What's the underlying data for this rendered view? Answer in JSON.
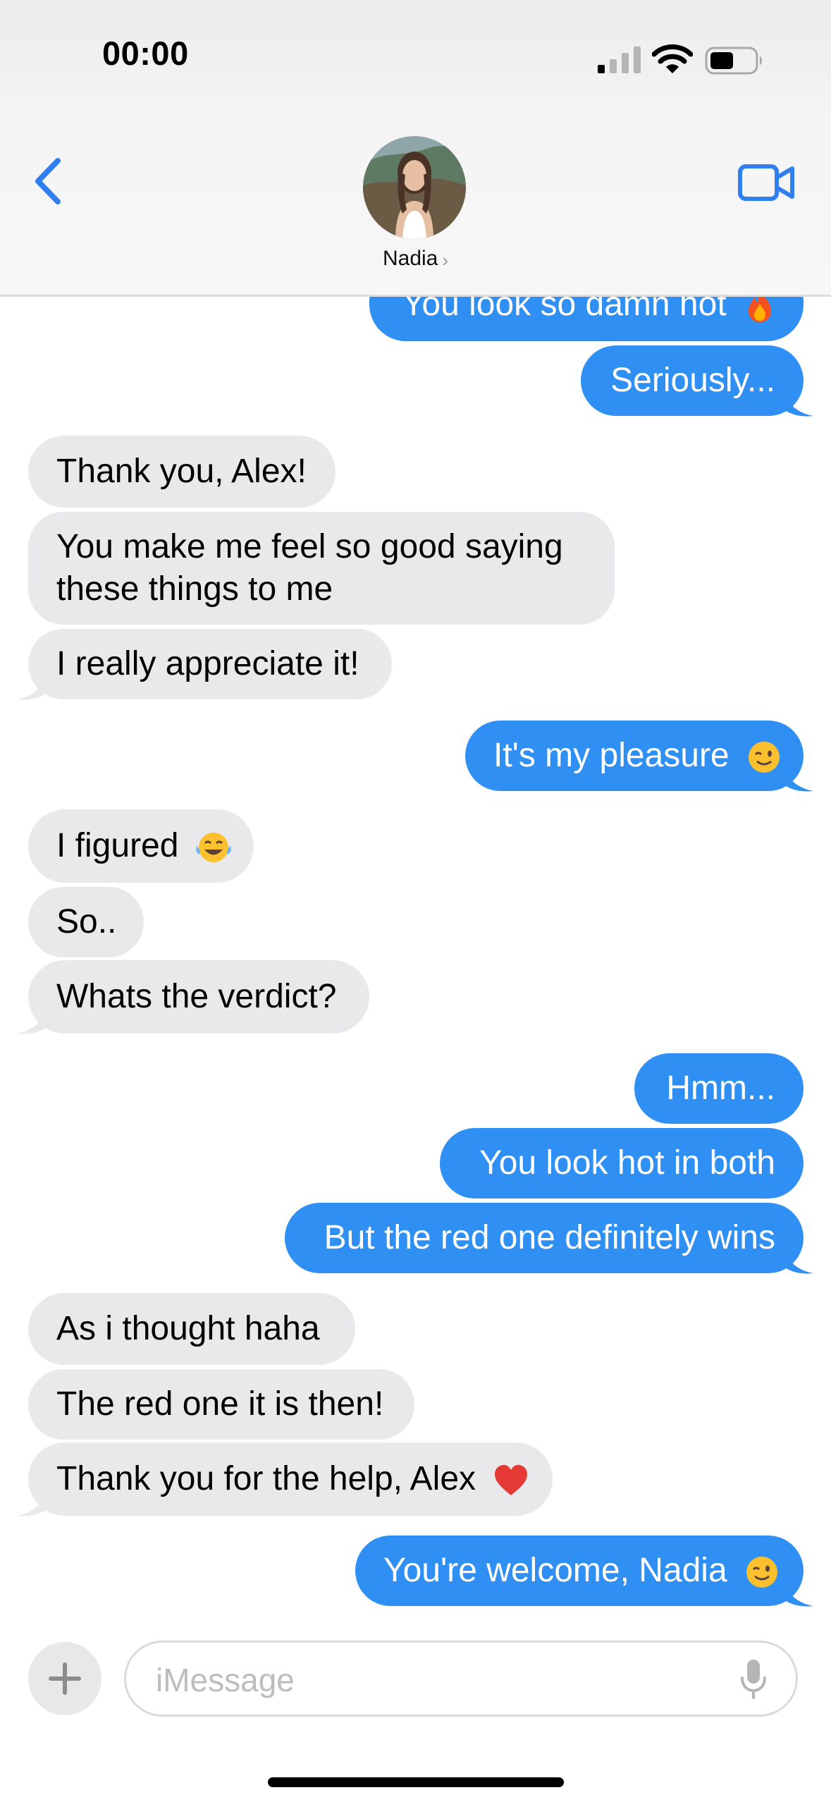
{
  "status_bar": {
    "time": "00:00"
  },
  "header": {
    "contact_name": "Nadia",
    "contact_chevron": "›",
    "back_icon": "chevron-left-icon",
    "video_icon": "video-camera-icon"
  },
  "colors": {
    "sent_bubble": "#2f8ff3",
    "received_bubble": "#e9e9eb",
    "accent": "#2f7ff0"
  },
  "messages": [
    {
      "direction": "sent",
      "text": "You look so damn hot",
      "emoji": "fire"
    },
    {
      "direction": "sent",
      "text": "Seriously..."
    },
    {
      "direction": "received",
      "text": "Thank you, Alex!"
    },
    {
      "direction": "received",
      "text": "You make me feel so good saying these things to me"
    },
    {
      "direction": "received",
      "text": "I really appreciate it!"
    },
    {
      "direction": "sent",
      "text": "It's my pleasure",
      "emoji": "winking-face"
    },
    {
      "direction": "received",
      "text": "I figured",
      "emoji": "tears-of-joy"
    },
    {
      "direction": "received",
      "text": "So.."
    },
    {
      "direction": "received",
      "text": "Whats the verdict?"
    },
    {
      "direction": "sent",
      "text": "Hmm..."
    },
    {
      "direction": "sent",
      "text": "You look hot in both"
    },
    {
      "direction": "sent",
      "text": "But the red one definitely wins"
    },
    {
      "direction": "received",
      "text": "As i thought haha"
    },
    {
      "direction": "received",
      "text": "The red one it is then!"
    },
    {
      "direction": "received",
      "text": "Thank you for the help, Alex",
      "emoji": "red-heart"
    },
    {
      "direction": "sent",
      "text": "You're welcome, Nadia",
      "emoji": "winking-face"
    }
  ],
  "composer": {
    "placeholder": "iMessage",
    "plus_icon": "plus-icon",
    "mic_icon": "microphone-icon"
  }
}
